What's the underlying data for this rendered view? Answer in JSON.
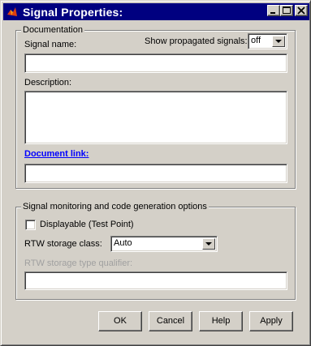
{
  "window": {
    "title": "Signal Properties:",
    "controls": {
      "minimize_icon": "minimize-icon",
      "maximize_icon": "maximize-icon",
      "close_icon": "close-icon"
    }
  },
  "documentation": {
    "group_title": "Documentation",
    "signal_name_label": "Signal name:",
    "signal_name_value": "",
    "show_propagated_label": "Show propagated signals:",
    "show_propagated_value": "off",
    "description_label": "Description:",
    "description_value": "",
    "document_link_label": "Document link:",
    "document_link_value": ""
  },
  "monitoring": {
    "group_title": "Signal monitoring and code generation options",
    "displayable_label": "Displayable (Test Point)",
    "displayable_checked": false,
    "rtw_storage_class_label": "RTW storage class:",
    "rtw_storage_class_value": "Auto",
    "rtw_type_qualifier_label": "RTW storage type qualifier:",
    "rtw_type_qualifier_value": ""
  },
  "buttons": {
    "ok": "OK",
    "cancel": "Cancel",
    "help": "Help",
    "apply": "Apply"
  },
  "colors": {
    "face": "#d4d0c8",
    "titlebar": "#000080",
    "link": "#0000ff",
    "disabled_text": "#a0a0a0"
  }
}
